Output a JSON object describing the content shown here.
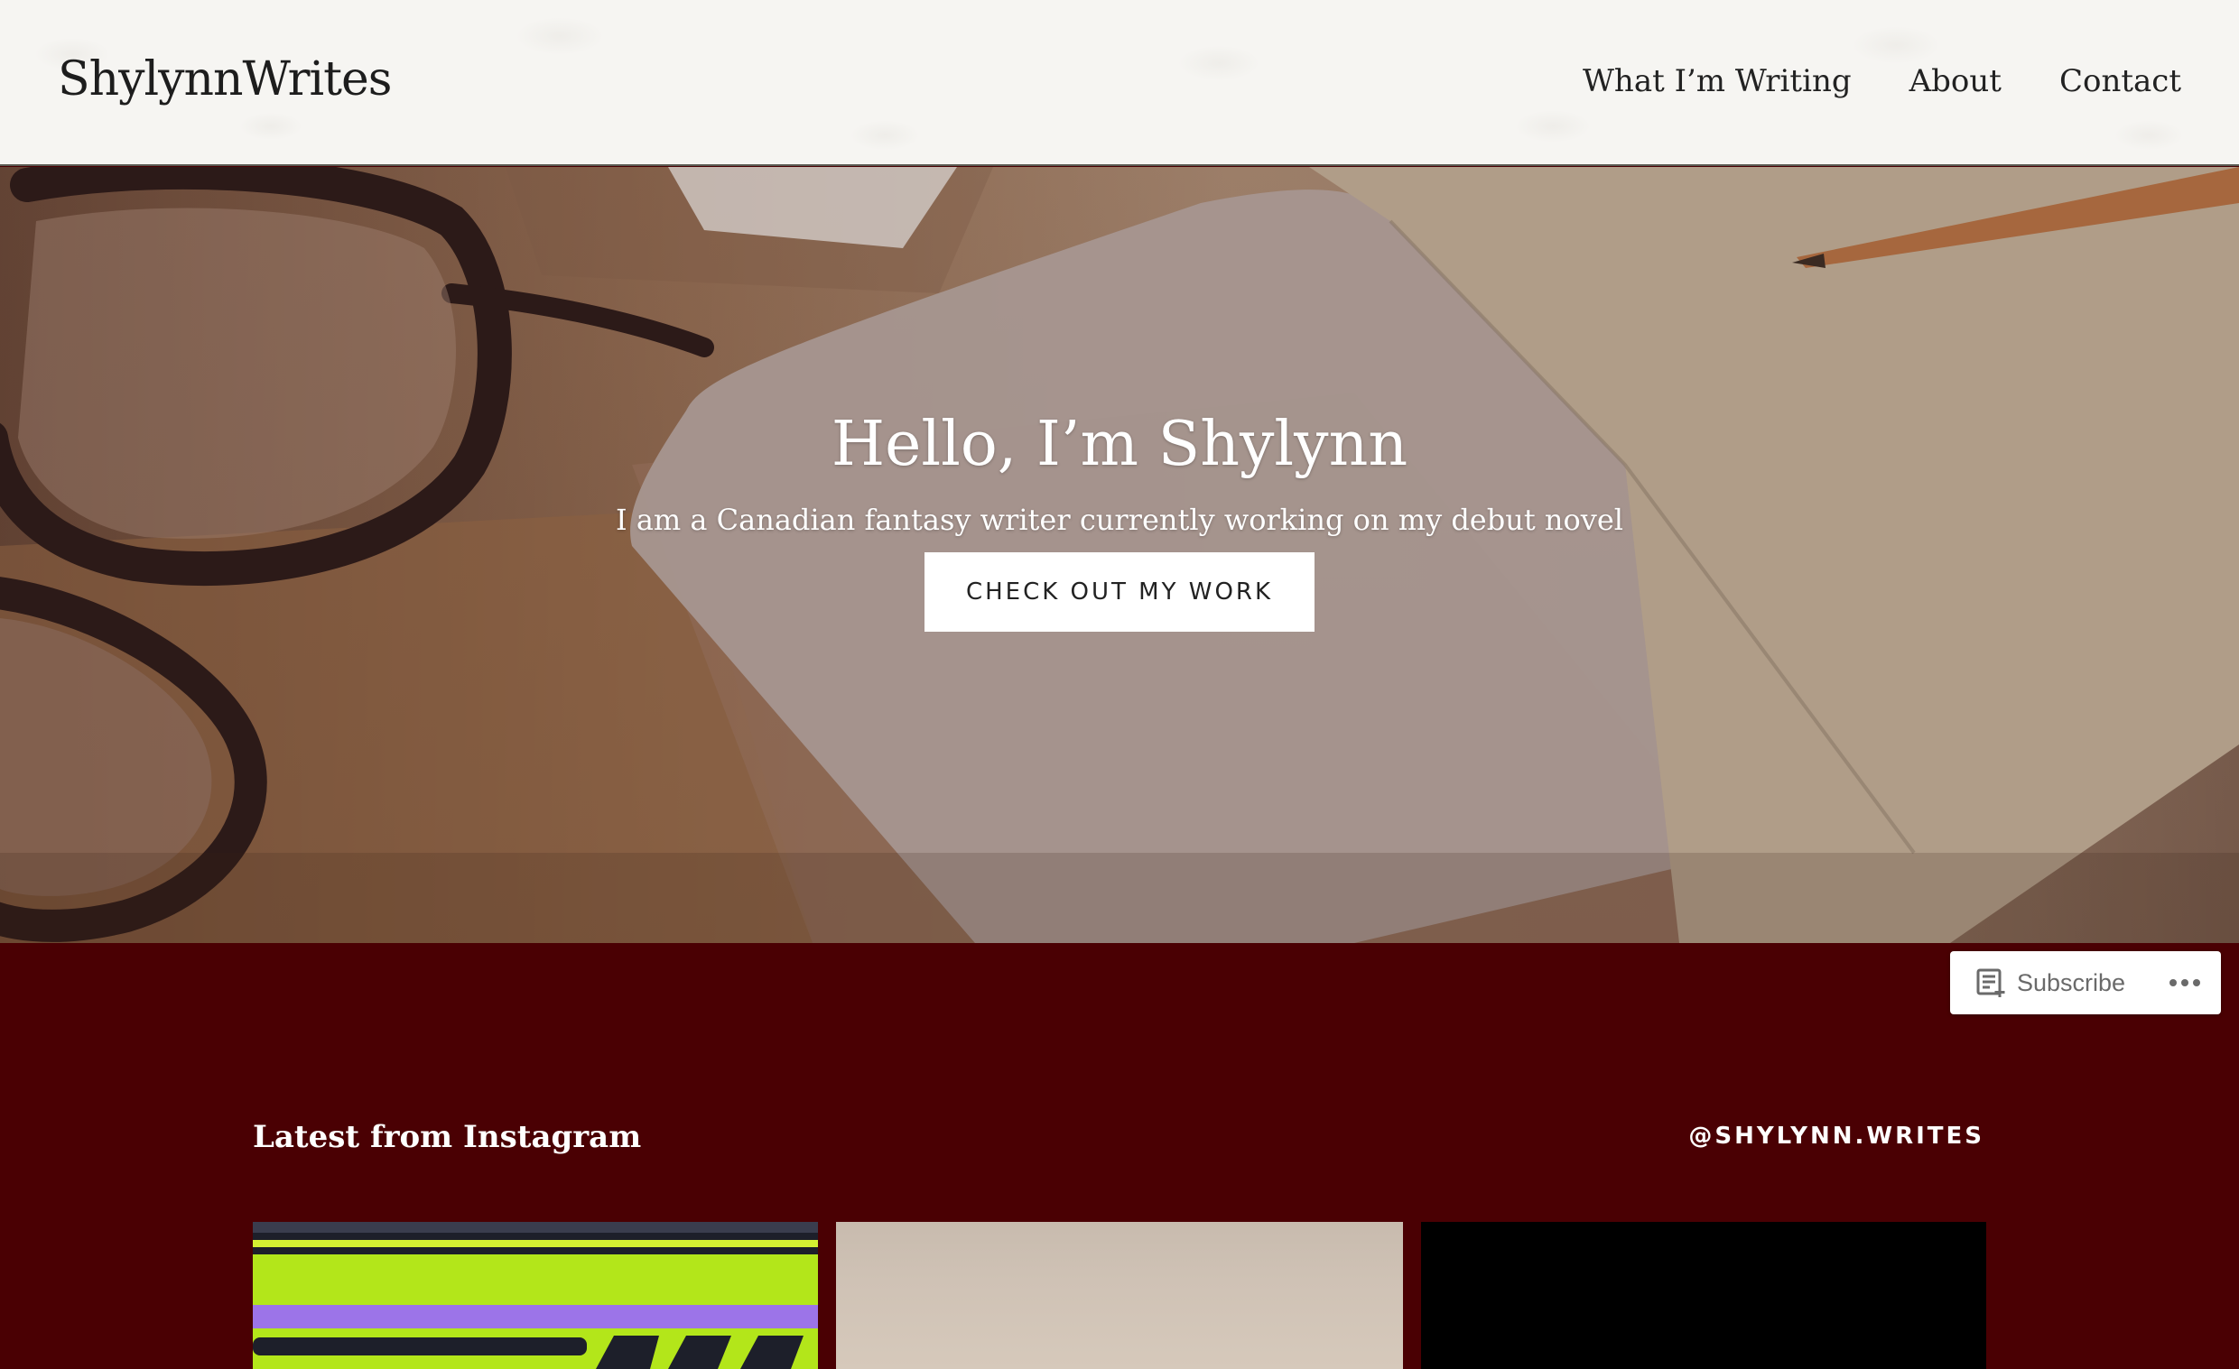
{
  "header": {
    "site_title": "ShylynnWrites",
    "nav": [
      "What I’m Writing",
      "About",
      "Contact"
    ]
  },
  "hero": {
    "title": "Hello, I’m Shylynn",
    "subtitle": "I am a Canadian fantasy writer currently working on my debut novel",
    "button_label": "CHECK OUT MY WORK"
  },
  "subscribe": {
    "label": "Subscribe",
    "icon": "reader-subscribe-icon",
    "more_icon": "ellipsis-icon"
  },
  "instagram": {
    "heading": "Latest from Instagram",
    "handle": "@SHYLYNN.WRITES"
  },
  "colors": {
    "section_background": "#4a0003",
    "header_background": "#f6f5f2",
    "button_background": "#ffffff"
  }
}
